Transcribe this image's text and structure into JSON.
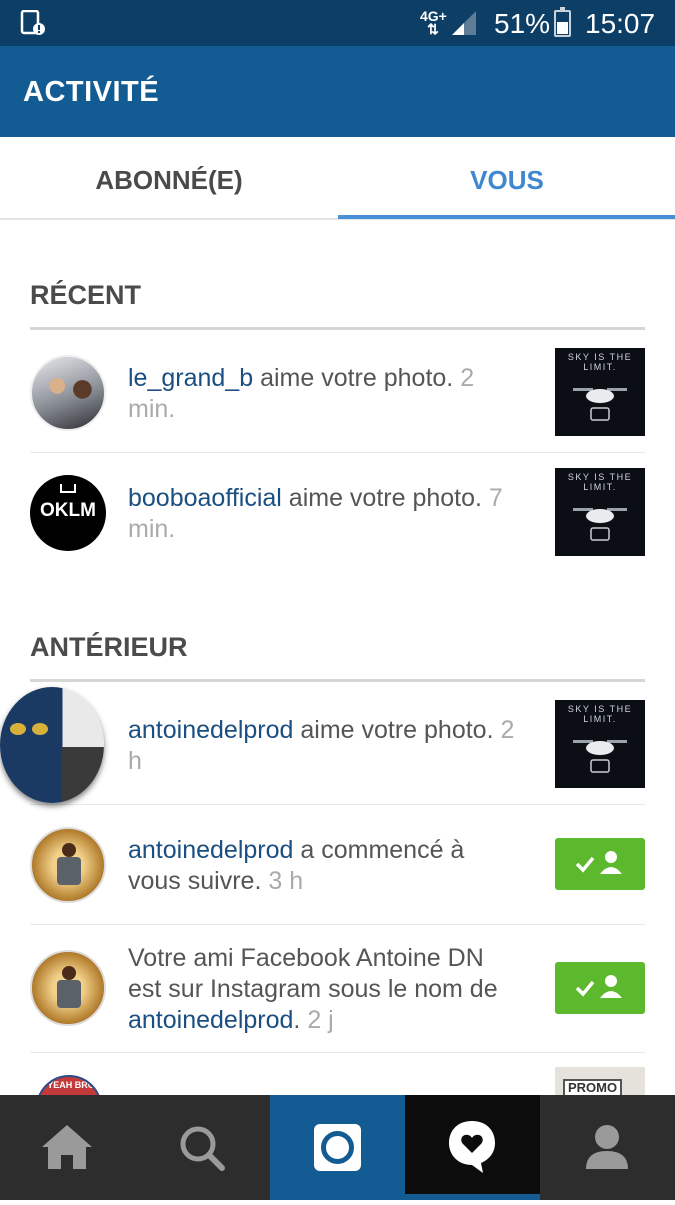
{
  "status": {
    "network": "4G+",
    "battery": "51%",
    "battery_level": 0.51,
    "time": "15:07"
  },
  "header": {
    "title": "ACTIVITÉ"
  },
  "tabs": [
    {
      "label": "ABONNÉ(E)"
    },
    {
      "label": "VOUS",
      "active": true
    }
  ],
  "sections": {
    "recent": "RÉCENT",
    "earlier": "ANTÉRIEUR"
  },
  "recent": [
    {
      "user": "le_grand_b",
      "action": " aime votre photo. ",
      "time": "2 min."
    },
    {
      "user": "booboaofficial",
      "action": " aime votre photo. ",
      "time": "7 min."
    }
  ],
  "earlier": [
    {
      "user": "antoinedelprod",
      "action": " aime votre photo. ",
      "time": "2 h"
    },
    {
      "user": "antoinedelprod",
      "action": " a commencé à vous suivre. ",
      "time": "3 h"
    },
    {
      "prefix": "Votre ami Facebook Antoine DN est sur Instagram sous le nom de ",
      "user": "antoinedelprod",
      "suffix": ". ",
      "time": "2 j"
    }
  ],
  "thumbs": {
    "sky_text": "SKY IS THE LIMIT.",
    "promo_text": "PROMO"
  },
  "avatars": {
    "oklm": "OKLM",
    "yeah_bro": "YEAH BRO"
  },
  "nav": [
    "home-icon",
    "search-icon",
    "camera-icon",
    "activity-heart-icon",
    "profile-icon"
  ],
  "colors": {
    "appbar": "#135c93",
    "status": "#0d3e66",
    "link": "#1b4f82",
    "follow": "#5cb82d",
    "tab_active": "#3f87cf"
  }
}
